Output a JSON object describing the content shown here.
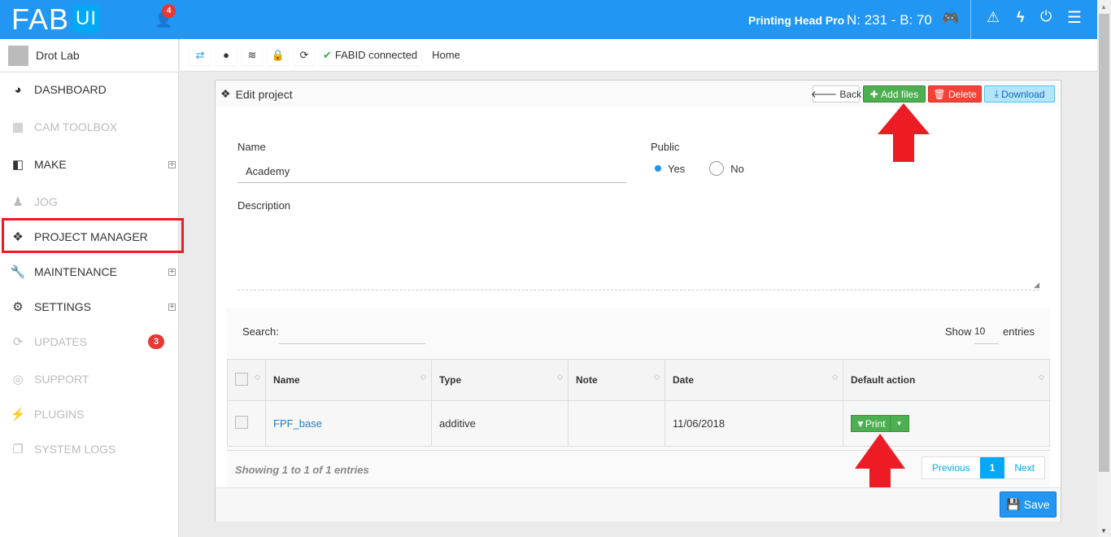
{
  "topbar": {
    "logo": "FAB",
    "logo_ui": "UI",
    "notif_count": "4",
    "head": "Printing Head Pro",
    "nb": "N: 231 - B: 70"
  },
  "sidebar": {
    "user": "Drot Lab",
    "items": [
      {
        "label": "DASHBOARD",
        "icon": "dashboard-icon",
        "glyph": "◕",
        "disabled": false,
        "expand": false
      },
      {
        "label": "CAM TOOLBOX",
        "icon": "cam-toolbox-icon",
        "glyph": "▦",
        "disabled": true,
        "expand": false
      },
      {
        "label": "MAKE",
        "icon": "cube-icon",
        "glyph": "◧",
        "disabled": false,
        "expand": true
      },
      {
        "label": "JOG",
        "icon": "joystick-icon",
        "glyph": "♟",
        "disabled": true,
        "expand": false
      },
      {
        "label": "PROJECT MANAGER",
        "icon": "cubes-icon",
        "glyph": "❖",
        "disabled": false,
        "expand": false
      },
      {
        "label": "MAINTENANCE",
        "icon": "wrench-icon",
        "glyph": "🔧",
        "disabled": false,
        "expand": true
      },
      {
        "label": "SETTINGS",
        "icon": "gears-icon",
        "glyph": "⚙",
        "disabled": false,
        "expand": true
      },
      {
        "label": "UPDATES",
        "icon": "refresh-icon",
        "glyph": "⟳",
        "disabled": true,
        "expand": false,
        "badge": "3"
      },
      {
        "label": "SUPPORT",
        "icon": "life-ring-icon",
        "glyph": "◎",
        "disabled": true,
        "expand": false
      },
      {
        "label": "PLUGINS",
        "icon": "plug-icon",
        "glyph": "⚡",
        "disabled": true,
        "expand": false
      },
      {
        "label": "SYSTEM LOGS",
        "icon": "copy-icon",
        "glyph": "❐",
        "disabled": true,
        "expand": false
      }
    ]
  },
  "ribbon": {
    "fabid": "FABID connected",
    "breadcrumb": "Home"
  },
  "panel": {
    "title": "Edit project",
    "back": "Back",
    "add": "Add files",
    "delete": "Delete",
    "download": "Download",
    "name_label": "Name",
    "name_value": "Academy",
    "public_label": "Public",
    "yes": "Yes",
    "no": "No",
    "desc_label": "Description",
    "search_label": "Search:",
    "show": "Show",
    "entries_count": "10",
    "entries": "entries",
    "columns": [
      "Name",
      "Type",
      "Note",
      "Date",
      "Default action"
    ],
    "rows": [
      {
        "name": "FPF_base",
        "type": "additive",
        "note": "",
        "date": "11/06/2018",
        "action": "Print"
      }
    ],
    "info": "Showing 1 to 1 of 1 entries",
    "prev": "Previous",
    "page": "1",
    "next": "Next",
    "save": "Save"
  },
  "colors": {
    "primary": "#2196f3",
    "success": "#4caf50",
    "danger": "#f44336",
    "annotation": "#ed1c24"
  }
}
